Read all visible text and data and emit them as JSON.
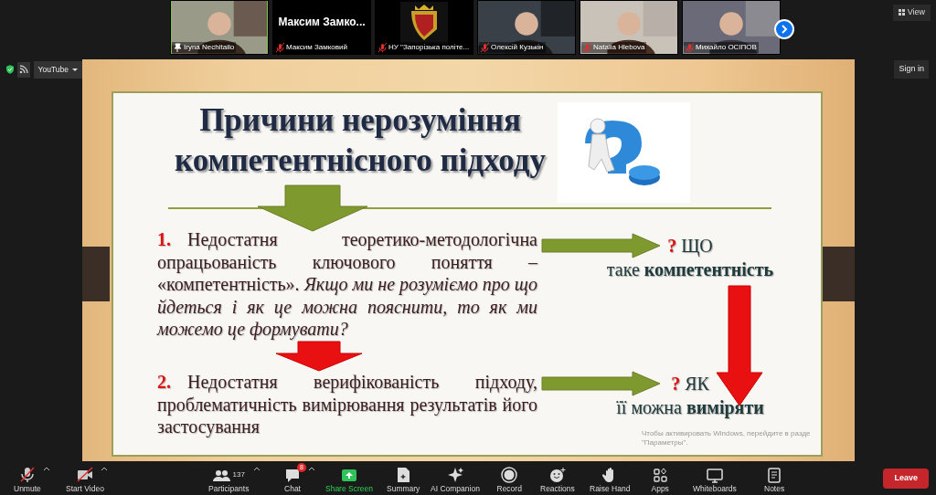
{
  "participants_strip": {
    "tiles": [
      {
        "kind": "video",
        "label": "Iryna Nechitailo",
        "muted": false,
        "pinned": true,
        "speaking": true
      },
      {
        "kind": "name",
        "display_name": "Максим Замко...",
        "label": "Максим Замковий",
        "muted": true,
        "pinned": false,
        "speaking": false
      },
      {
        "kind": "logo",
        "label": "НУ \"Запорізька політе...",
        "muted": true,
        "pinned": false,
        "speaking": false
      },
      {
        "kind": "video",
        "label": "Олексій Кузькін",
        "muted": true,
        "pinned": false,
        "speaking": false
      },
      {
        "kind": "video",
        "label": "Natalia Hlebova",
        "muted": true,
        "pinned": false,
        "speaking": false
      },
      {
        "kind": "video",
        "label": "Михайло ОСІПОВ",
        "muted": true,
        "pinned": false,
        "speaking": false
      }
    ],
    "view_button": "View"
  },
  "share_controls": {
    "source": "YouTube",
    "sign_in": "Sign in"
  },
  "slide": {
    "title": [
      "Причини нерозуміння",
      "компетентнісного підходу"
    ],
    "points": [
      {
        "number": "1.",
        "text": "Недостатня теоретико-методологічна опрацьованість ключового поняття – «компетентність». *Якщо ми не розуміємо про що йдеться і як це можна пояснити, то як ми можемо це формувати?*",
        "mark": "?",
        "question": "ЩО",
        "answer": "таке **компетентність**"
      },
      {
        "number": "2.",
        "text": "Недостатня верифікованість підходу, проблематичність вимірювання результатів його застосування",
        "mark": "?",
        "question": "ЯК",
        "answer": "її можна **виміряти**"
      }
    ]
  },
  "os_notice": [
    "Чтобы активировать Windows, перейдите в разде",
    "\"Параметры\"."
  ],
  "toolbar": {
    "items": [
      {
        "kind": "mic",
        "label": "Unmute",
        "off": true,
        "caret": true
      },
      {
        "kind": "camera",
        "label": "Start Video",
        "off": true,
        "caret": true
      },
      {
        "kind": "people",
        "label": "Participants",
        "count": "137",
        "caret": true
      },
      {
        "kind": "chat",
        "label": "Chat",
        "badge": "8",
        "caret": true
      },
      {
        "kind": "share",
        "label": "Share Screen",
        "accent": true
      },
      {
        "kind": "doc",
        "label": "Summary"
      },
      {
        "kind": "sparkle",
        "label": "AI Companion"
      },
      {
        "kind": "record",
        "label": "Record"
      },
      {
        "kind": "smile",
        "label": "Reactions"
      },
      {
        "kind": "hand",
        "label": "Raise Hand"
      },
      {
        "kind": "apps",
        "label": "Apps"
      },
      {
        "kind": "board",
        "label": "Whiteboards"
      },
      {
        "kind": "notes",
        "label": "Notes"
      }
    ],
    "leave_button": "Leave"
  }
}
